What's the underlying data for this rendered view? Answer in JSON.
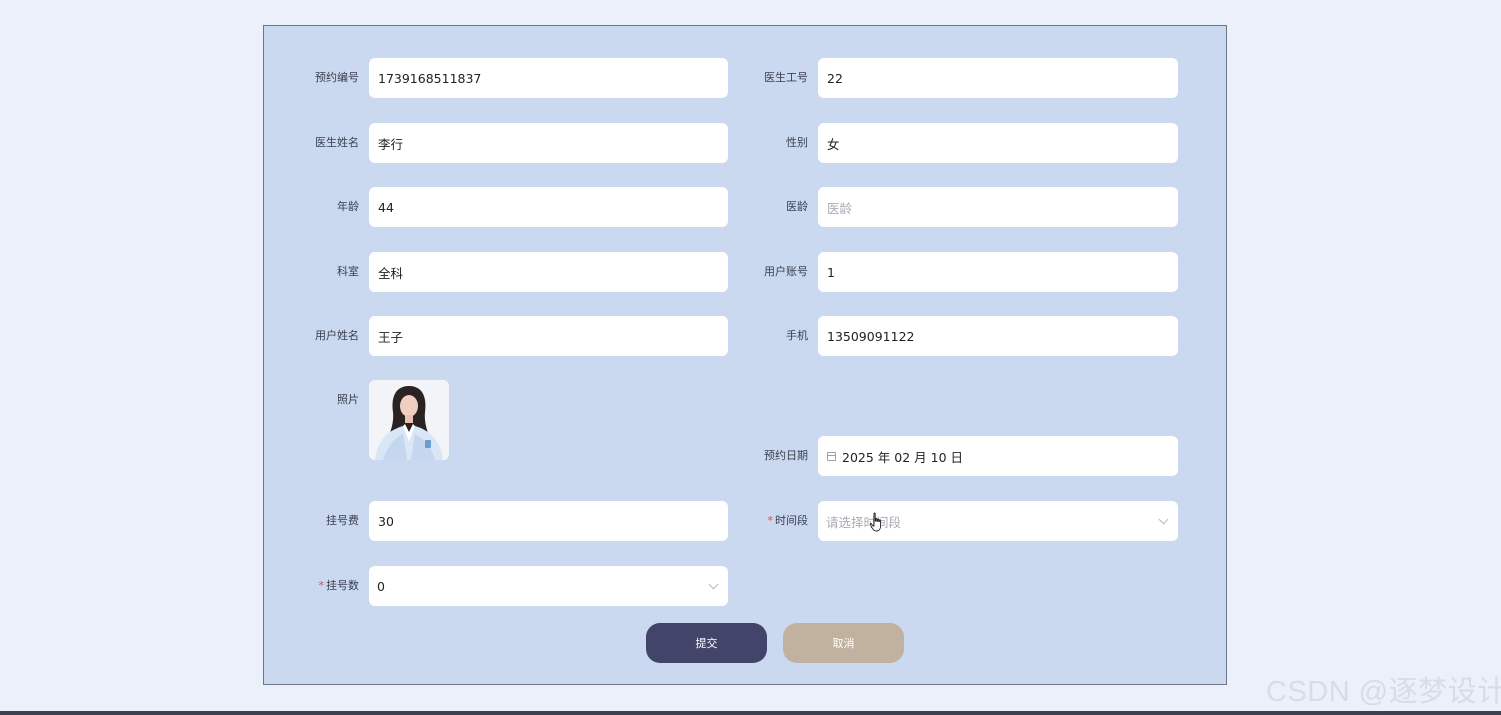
{
  "form": {
    "booking_no": {
      "label": "预约编号",
      "value": "1739168511837"
    },
    "doctor_id": {
      "label": "医生工号",
      "value": "22"
    },
    "doctor_name": {
      "label": "医生姓名",
      "value": "李行"
    },
    "gender": {
      "label": "性别",
      "value": "女"
    },
    "age": {
      "label": "年龄",
      "value": "44"
    },
    "years_practice": {
      "label": "医龄",
      "value": "",
      "placeholder": "医龄"
    },
    "department": {
      "label": "科室",
      "value": "全科"
    },
    "user_account": {
      "label": "用户账号",
      "value": "1"
    },
    "user_name": {
      "label": "用户姓名",
      "value": "王子"
    },
    "phone": {
      "label": "手机",
      "value": "13509091122"
    },
    "photo": {
      "label": "照片"
    },
    "booking_date": {
      "label": "预约日期",
      "value": "2025 年 02 月 10 日"
    },
    "fee": {
      "label": "挂号费",
      "value": "30"
    },
    "time_slot": {
      "label": "时间段",
      "required_mark": "*",
      "value": "",
      "placeholder": "请选择时间段"
    },
    "reg_count": {
      "label": "挂号数",
      "required_mark": "*",
      "value": "0"
    }
  },
  "buttons": {
    "submit": "提交",
    "cancel": "取消"
  },
  "watermark": "CSDN @逐梦设计",
  "colors": {
    "panel": "#cbd9f0",
    "submit": "#42446a",
    "cancel": "#c1b29f",
    "required": "#e0444d"
  }
}
